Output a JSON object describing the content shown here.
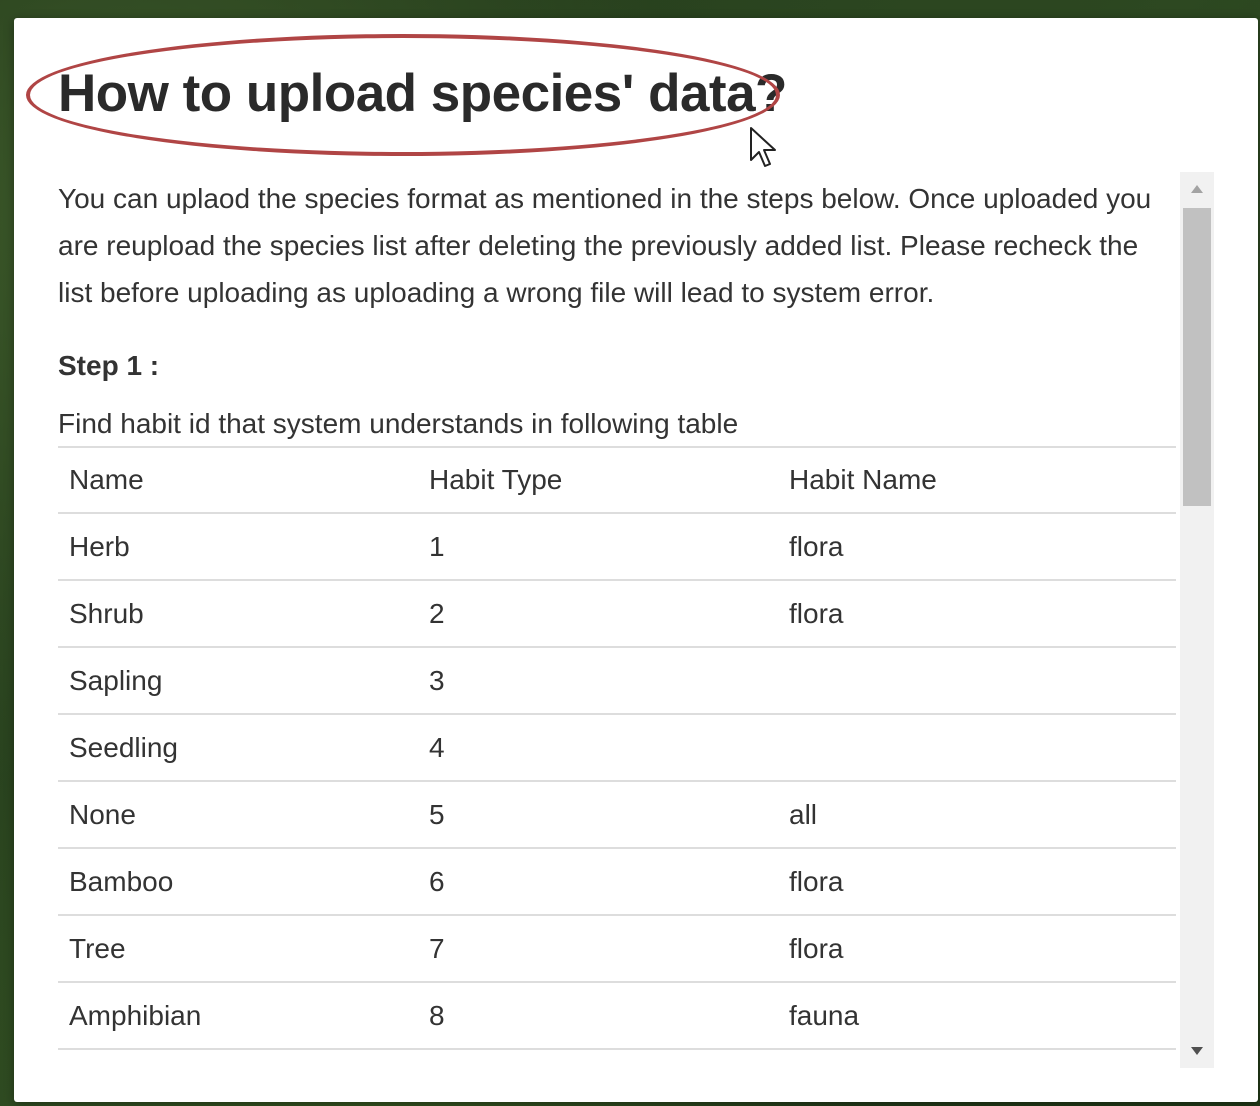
{
  "modal": {
    "title": "How to upload species' data?",
    "intro": "You can uplaod the species format as mentioned in the steps below. Once uploaded you are reupload the species list after deleting the previously added list. Please recheck the list before uploading as uploading a wrong file will lead to system error.",
    "step1_label": "Step 1 :",
    "step1_desc": "Find habit id that system understands in following table",
    "table": {
      "headers": [
        "Name",
        "Habit Type",
        "Habit Name"
      ],
      "rows": [
        [
          "Herb",
          "1",
          "flora"
        ],
        [
          "Shrub",
          "2",
          "flora"
        ],
        [
          "Sapling",
          "3",
          ""
        ],
        [
          "Seedling",
          "4",
          ""
        ],
        [
          "None",
          "5",
          "all"
        ],
        [
          "Bamboo",
          "6",
          "flora"
        ],
        [
          "Tree",
          "7",
          "flora"
        ],
        [
          "Amphibian",
          "8",
          "fauna"
        ]
      ]
    }
  },
  "colors": {
    "highlight_ellipse": "#b04545",
    "text": "#333333",
    "row_border": "#dddddd",
    "scroll_track": "#f1f1f1",
    "scroll_thumb": "#c1c1c1"
  },
  "icons": {
    "cursor": "mouse-pointer-icon",
    "scroll_up": "scroll-up-arrow-icon",
    "scroll_down": "scroll-down-arrow-icon"
  }
}
